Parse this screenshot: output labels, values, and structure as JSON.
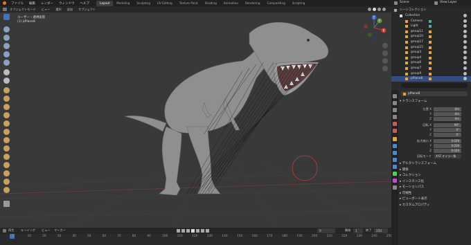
{
  "topbar": {
    "menus": [
      "ファイル",
      "編集",
      "レンダー",
      "ウィンドウ",
      "ヘルプ"
    ],
    "workspaces": [
      "Layout",
      "Modeling",
      "Sculpting",
      "UV Editing",
      "Texture Paint",
      "Shading",
      "Animation",
      "Rendering",
      "Compositing",
      "Scripting"
    ],
    "scene": "Scene",
    "view_layer": "View Layer"
  },
  "viewport": {
    "header_items": [
      "オブジェクトモード",
      "ビュー",
      "選択",
      "追加",
      "オブジェクト"
    ],
    "view_label": "ユーザー・透視投影",
    "object_label": "(1) pPlane8",
    "gizmo": {
      "x": "X",
      "y": "Y",
      "z": "Z"
    }
  },
  "timeline": {
    "header_items": [
      "再生",
      "キーイング",
      "ビュー",
      "マーカー"
    ],
    "frame_current": "0",
    "start_label": "開始",
    "start": "1",
    "end_label": "終了",
    "end": "250",
    "ticks": [
      "0",
      "10",
      "20",
      "30",
      "40",
      "50",
      "60",
      "70",
      "80",
      "90",
      "100",
      "110",
      "120",
      "130",
      "140",
      "150",
      "160",
      "170",
      "180",
      "190",
      "200",
      "210",
      "220",
      "230",
      "240",
      "250"
    ]
  },
  "outliner": {
    "title": "シーンコレクション",
    "rows": [
      {
        "label": "Collection",
        "indent": 0
      },
      {
        "label": "Camera",
        "indent": 1
      },
      {
        "label": "Light",
        "indent": 1
      },
      {
        "label": "group11",
        "indent": 1
      },
      {
        "label": "group10",
        "indent": 1
      },
      {
        "label": "group17",
        "indent": 1
      },
      {
        "label": "group15",
        "indent": 1
      },
      {
        "label": "group3",
        "indent": 1
      },
      {
        "label": "group4",
        "indent": 1
      },
      {
        "label": "group6",
        "indent": 1
      },
      {
        "label": "group7",
        "indent": 1
      },
      {
        "label": "group9",
        "indent": 1
      },
      {
        "label": "pPlane8",
        "indent": 1
      }
    ]
  },
  "properties": {
    "object_name": "pPlane8",
    "transform_title": "トランスフォーム",
    "location_label": "位置 X",
    "rotation_label": "回転 X",
    "scale_label": "拡大縮小 X",
    "axis_y": "Y",
    "axis_z": "Z",
    "location": [
      "0m",
      "0m",
      "0m"
    ],
    "rotation": [
      "90°",
      "0°",
      "0°"
    ],
    "scale": [
      "0.039",
      "0.039",
      "0.039"
    ],
    "mode_label": "回転モード",
    "mode_value": "XYZ オイラー角",
    "panels": [
      "デルタトランスフォーム",
      "関係",
      "コレクション",
      "インスタンス化",
      "モーションパス",
      "可視性",
      "ビューポート表示",
      "カスタムプロパティ"
    ]
  },
  "colors": {
    "accent": "#4772b3",
    "active_object": "#e8a53c",
    "cursor_red": "#c83c3c"
  }
}
